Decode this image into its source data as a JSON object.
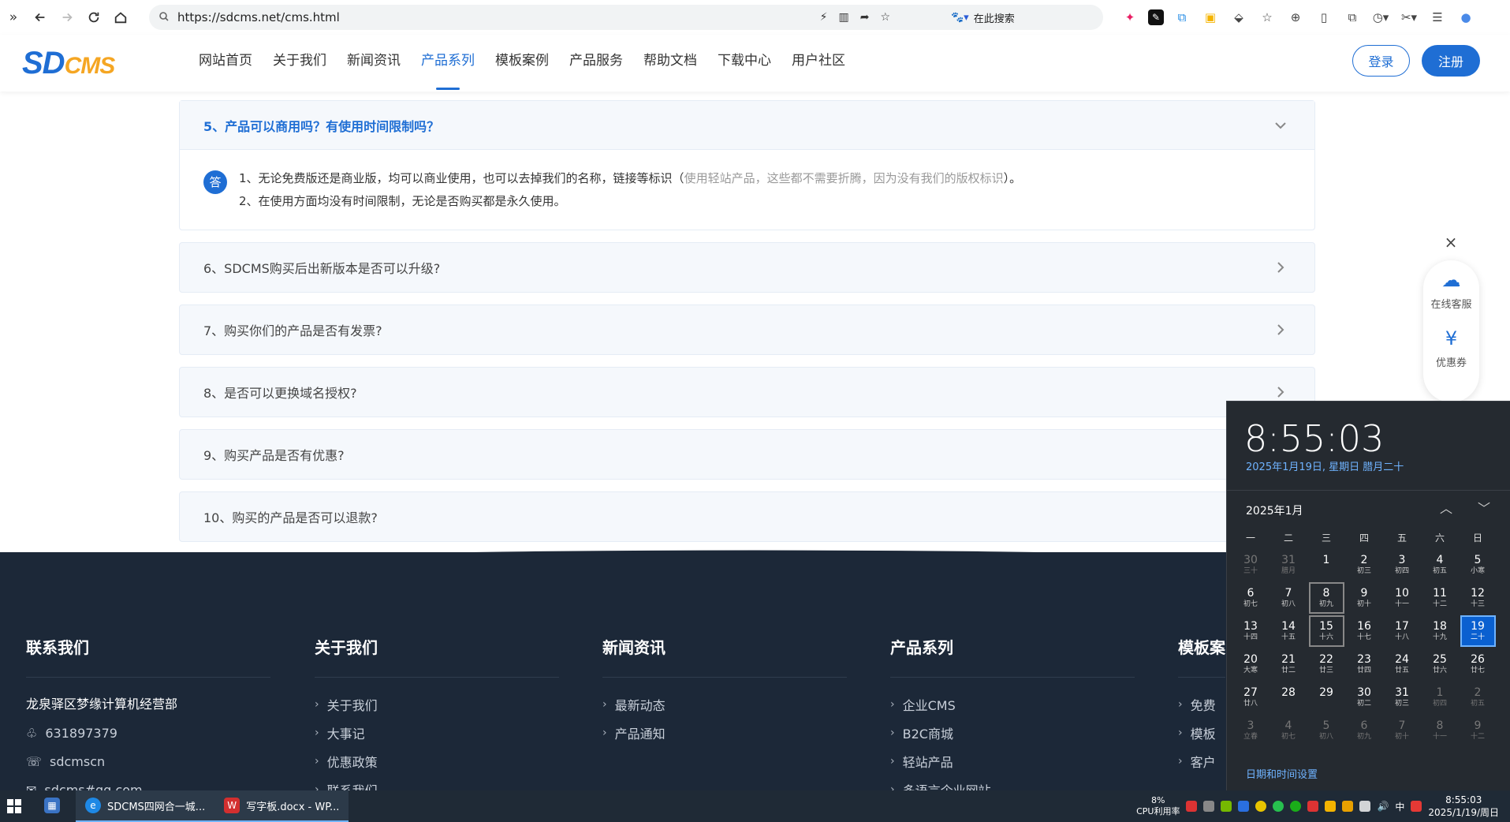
{
  "browser": {
    "url": "https://sdcms.net/cms.html",
    "search_placeholder": "在此搜索"
  },
  "site": {
    "logo_sd": "SD",
    "logo_cms": "CMS",
    "nav": [
      "网站首页",
      "关于我们",
      "新闻资讯",
      "产品系列",
      "模板案例",
      "产品服务",
      "帮助文档",
      "下载中心",
      "用户社区"
    ],
    "active_nav": "产品系列",
    "login": "登录",
    "register": "注册"
  },
  "faq": {
    "open_question": "5、产品可以商用吗？有使用时间限制吗？",
    "answer_badge": "答",
    "answer_line1_a": "1、无论免费版还是商业版，均可以商业使用，也可以去掉我们的名称，链接等标识（",
    "answer_line1_muted": "使用轻站产品，这些都不需要折腾，因为没有我们的版权标识",
    "answer_line1_b": "）。",
    "answer_line2": "2、在使用方面均没有时间限制，无论是否购买都是永久使用。",
    "questions": [
      "6、SDCMS购买后出新版本是否可以升级?",
      "7、购买你们的产品是否有发票?",
      "8、是否可以更换域名授权?",
      "9、购买产品是否有优惠?",
      "10、购买的产品是否可以退款?"
    ]
  },
  "float": {
    "close": "×",
    "service": "在线客服",
    "coupon": "优惠券"
  },
  "footer": {
    "contact_title": "联系我们",
    "company": "龙泉驿区梦缘计算机经营部",
    "qq": "631897379",
    "wechat": "sdcmscn",
    "email": "sdcms#qq.com",
    "about_title": "关于我们",
    "about_links": [
      "关于我们",
      "大事记",
      "优惠政策",
      "联系我们"
    ],
    "news_title": "新闻资讯",
    "news_links": [
      "最新动态",
      "产品通知"
    ],
    "product_title": "产品系列",
    "product_links": [
      "企业CMS",
      "B2C商城",
      "轻站产品",
      "多语言企业网站"
    ],
    "template_title": "模板案",
    "template_links": [
      "免费",
      "模板",
      "客户"
    ]
  },
  "calendar": {
    "time": "8:55:03",
    "date": "2025年1月19日, 星期日 腊月二十",
    "month": "2025年1月",
    "weekdays": [
      "一",
      "二",
      "三",
      "四",
      "五",
      "六",
      "日"
    ],
    "weeks": [
      [
        [
          "30",
          "三十",
          "o"
        ],
        [
          "31",
          "腊月",
          "o"
        ],
        [
          "1",
          "",
          ""
        ],
        [
          "2",
          "初三",
          ""
        ],
        [
          "3",
          "初四",
          ""
        ],
        [
          "4",
          "初五",
          ""
        ],
        [
          "5",
          "小寒",
          ""
        ]
      ],
      [
        [
          "6",
          "初七",
          ""
        ],
        [
          "7",
          "初八",
          ""
        ],
        [
          "8",
          "初九",
          "b"
        ],
        [
          "9",
          "初十",
          ""
        ],
        [
          "10",
          "十一",
          ""
        ],
        [
          "11",
          "十二",
          ""
        ],
        [
          "12",
          "十三",
          ""
        ]
      ],
      [
        [
          "13",
          "十四",
          ""
        ],
        [
          "14",
          "十五",
          ""
        ],
        [
          "15",
          "十六",
          "b"
        ],
        [
          "16",
          "十七",
          ""
        ],
        [
          "17",
          "十八",
          ""
        ],
        [
          "18",
          "十九",
          ""
        ],
        [
          "19",
          "二十",
          "t"
        ]
      ],
      [
        [
          "20",
          "大寒",
          ""
        ],
        [
          "21",
          "廿二",
          ""
        ],
        [
          "22",
          "廿三",
          ""
        ],
        [
          "23",
          "廿四",
          ""
        ],
        [
          "24",
          "廿五",
          ""
        ],
        [
          "25",
          "廿六",
          ""
        ],
        [
          "26",
          "廿七",
          ""
        ]
      ],
      [
        [
          "27",
          "廿八",
          ""
        ],
        [
          "28",
          "",
          ""
        ],
        [
          "29",
          "",
          ""
        ],
        [
          "30",
          "初二",
          ""
        ],
        [
          "31",
          "初三",
          ""
        ],
        [
          "1",
          "初四",
          "o"
        ],
        [
          "2",
          "初五",
          "o"
        ]
      ],
      [
        [
          "3",
          "立春",
          "o"
        ],
        [
          "4",
          "初七",
          "o"
        ],
        [
          "5",
          "初八",
          "o"
        ],
        [
          "6",
          "初九",
          "o"
        ],
        [
          "7",
          "初十",
          "o"
        ],
        [
          "8",
          "十一",
          "o"
        ],
        [
          "9",
          "十二",
          "o"
        ]
      ]
    ],
    "settings": "日期和时间设置"
  },
  "taskbar": {
    "app1": "SDCMS四网合一城...",
    "app2": "写字板.docx - WP...",
    "cpu_pct": "8%",
    "cpu_label": "CPU利用率",
    "ime": "中",
    "clock_time": "8:55:03",
    "clock_date": "2025/1/19/周日"
  }
}
